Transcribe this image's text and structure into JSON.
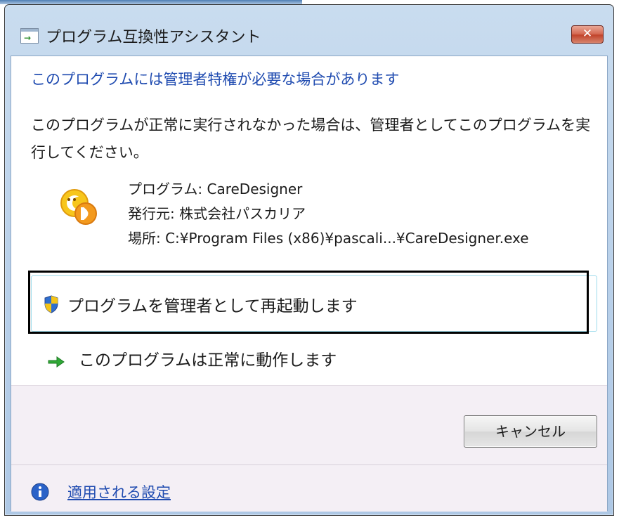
{
  "window": {
    "title": "プログラム互換性アシスタント",
    "close_label": "✕"
  },
  "dialog": {
    "heading": "このプログラムには管理者特権が必要な場合があります",
    "message": "このプログラムが正常に実行されなかった場合は、管理者としてこのプログラムを実行してください。",
    "program_name": "プログラム: CareDesigner",
    "publisher": "発行元: 株式会社パスカリア",
    "location": "場所: C:¥Program Files (x86)¥pascali...¥CareDesigner.exe"
  },
  "commands": {
    "restart_as_admin": "プログラムを管理者として再起動します",
    "works_correctly": "このプログラムは正常に動作します"
  },
  "footer": {
    "cancel_label": "キャンセル",
    "settings_link": "適用される設定"
  },
  "icons": {
    "app": "app-window-icon",
    "program": "caredesigner-program-icon",
    "shield": "uac-shield-icon",
    "arrow": "green-arrow-icon",
    "info": "info-icon"
  },
  "colors": {
    "heading_blue": "#1f4bb0",
    "link_blue": "#1f4bb0",
    "focus_border": "#000000",
    "command_border": "#9fdcec",
    "footer_bg": "#f4eff5"
  }
}
